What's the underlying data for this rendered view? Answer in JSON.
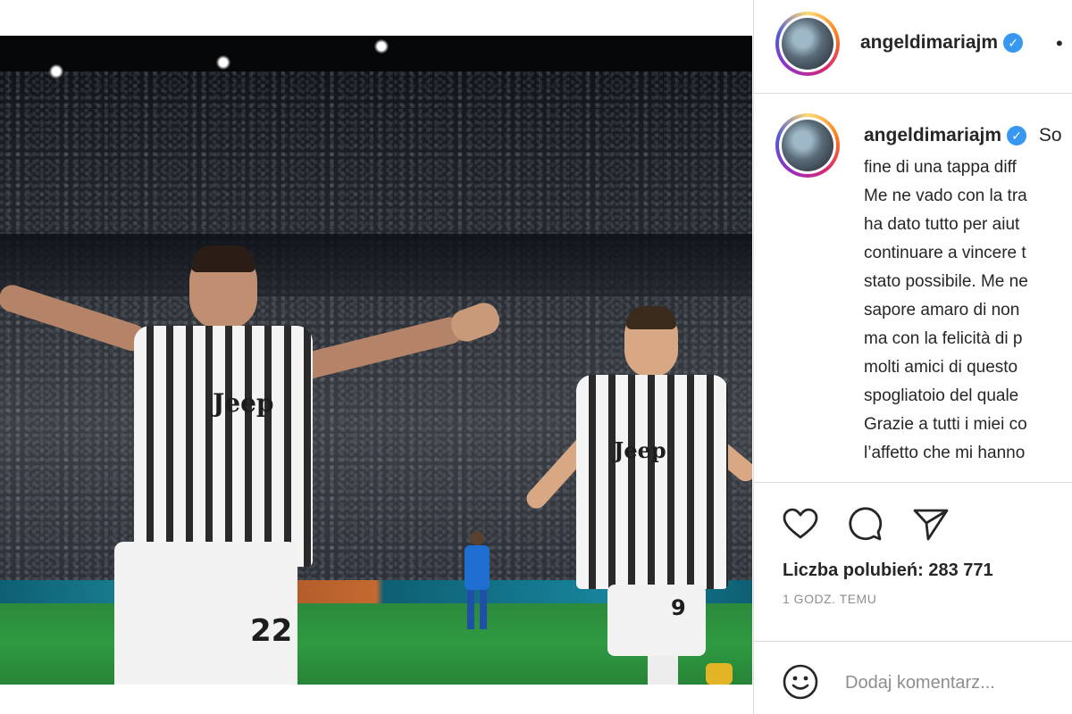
{
  "post": {
    "image_alt_icon": "post-photo",
    "jersey_text_left": "Jeep",
    "jersey_text_right": "Jeep",
    "number_left": "22",
    "number_right": "9"
  },
  "header": {
    "username": "angeldimariajm",
    "verified_icon": "verified-badge-icon",
    "more_glyph": "•"
  },
  "caption": {
    "username": "angeldimariajm",
    "first_line_start": "So",
    "lines": [
      "fine di una tappa diff",
      "Me ne vado con la tra",
      "ha dato tutto per aiut",
      "continuare a vincere t",
      "stato possibile. Me ne",
      "sapore amaro di non",
      "ma con la felicità di p",
      "molti amici di questo",
      "spogliatoio del quale",
      "Grazie a tutti i miei co",
      "l’affetto che mi hanno"
    ]
  },
  "actions": {
    "like_icon": "heart-icon",
    "comment_icon": "comment-icon",
    "share_icon": "send-icon"
  },
  "likes_text": "Liczba polubień: 283 771",
  "timestamp": "1 GODZ. TEMU",
  "comment": {
    "emoji_icon": "emoji-icon",
    "placeholder": "Dodaj komentarz..."
  },
  "colors": {
    "verified": "#3897f0",
    "muted_text": "#8e8e8e",
    "border": "#dbdbdb"
  }
}
